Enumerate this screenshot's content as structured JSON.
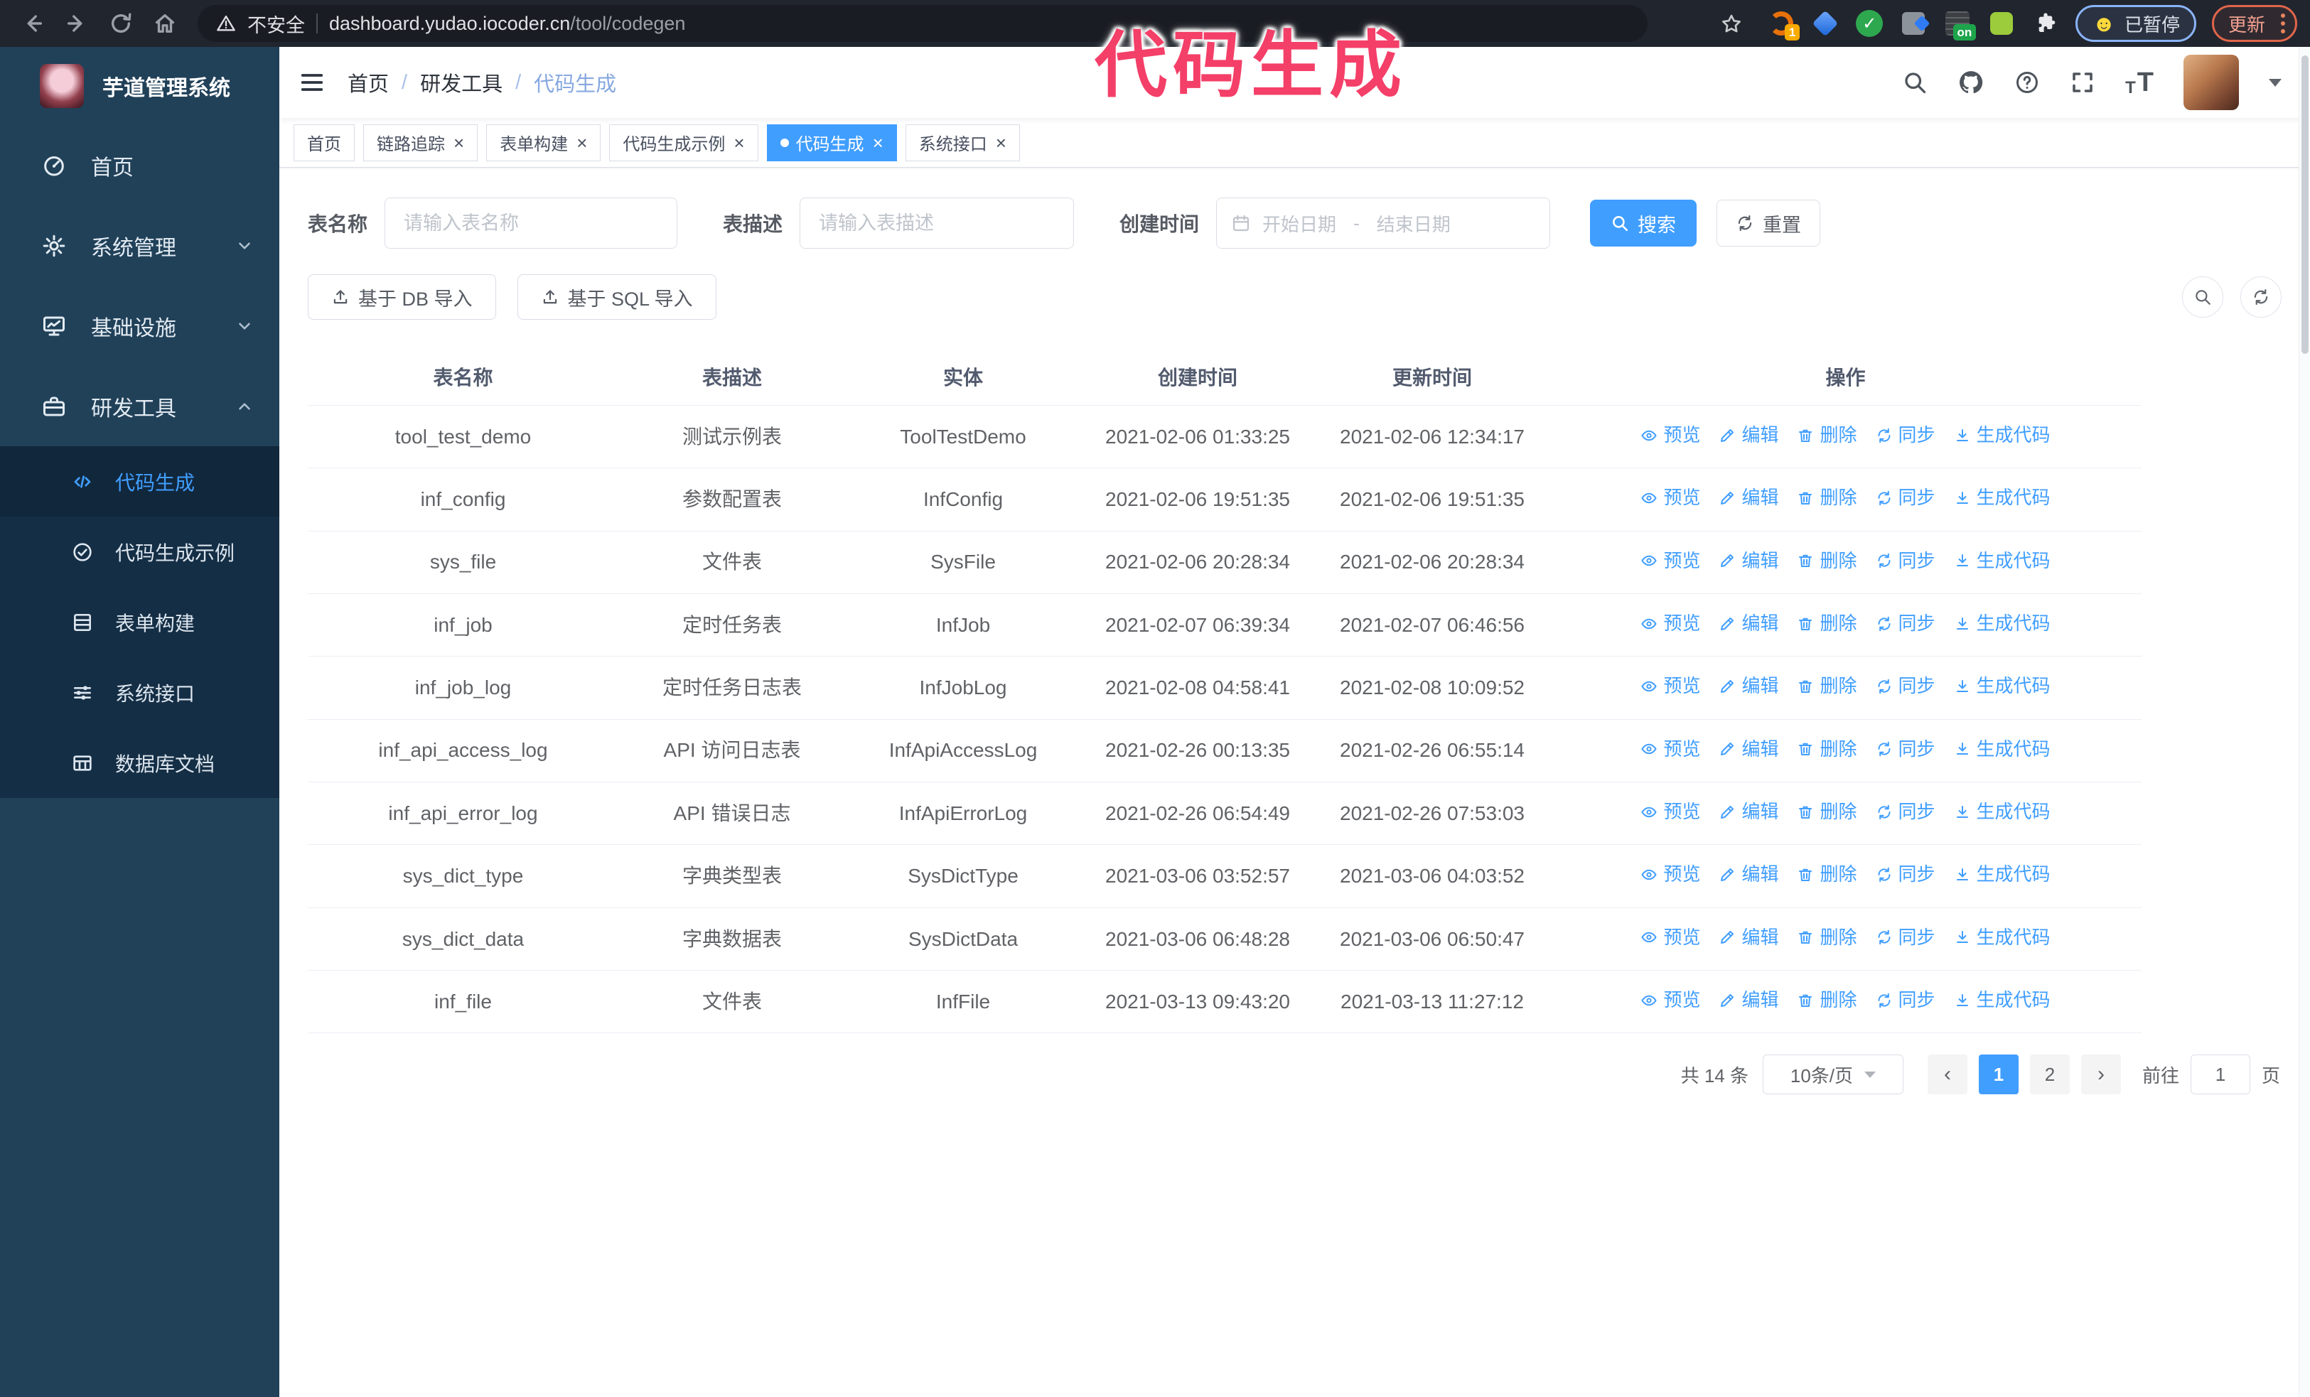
{
  "overlay": {
    "title": "代码生成",
    "color": "#f43f68"
  },
  "browser": {
    "security_label": "不安全",
    "url_host": "dashboard.yudao.iocoder.cn",
    "url_path": "/tool/codegen",
    "ext_badge": "1",
    "ext_on": "on",
    "paused_badge": "已暂停",
    "update_button": "更新"
  },
  "sidebar": {
    "logo_title": "芋道管理系统",
    "items": [
      {
        "label": "首页"
      },
      {
        "label": "系统管理"
      },
      {
        "label": "基础设施"
      },
      {
        "label": "研发工具"
      }
    ],
    "submenu": [
      {
        "label": "代码生成",
        "active": true
      },
      {
        "label": "代码生成示例",
        "active": false
      },
      {
        "label": "表单构建",
        "active": false
      },
      {
        "label": "系统接口",
        "active": false
      },
      {
        "label": "数据库文档",
        "active": false
      }
    ]
  },
  "breadcrumb": {
    "items": [
      "首页",
      "研发工具",
      "代码生成"
    ]
  },
  "tabs": [
    {
      "label": "首页",
      "closable": false,
      "active": false
    },
    {
      "label": "链路追踪",
      "closable": true,
      "active": false
    },
    {
      "label": "表单构建",
      "closable": true,
      "active": false
    },
    {
      "label": "代码生成示例",
      "closable": true,
      "active": false
    },
    {
      "label": "代码生成",
      "closable": true,
      "active": true
    },
    {
      "label": "系统接口",
      "closable": true,
      "active": false
    }
  ],
  "filters": {
    "table_name_label": "表名称",
    "table_name_placeholder": "请输入表名称",
    "table_desc_label": "表描述",
    "table_desc_placeholder": "请输入表描述",
    "create_time_label": "创建时间",
    "date_start_placeholder": "开始日期",
    "date_separator": "-",
    "date_end_placeholder": "结束日期",
    "search_label": "搜索",
    "reset_label": "重置"
  },
  "toolbar": {
    "import_db_label": "基于 DB 导入",
    "import_sql_label": "基于 SQL 导入"
  },
  "table": {
    "columns": [
      "表名称",
      "表描述",
      "实体",
      "创建时间",
      "更新时间",
      "操作"
    ],
    "actions": [
      "预览",
      "编辑",
      "删除",
      "同步",
      "生成代码"
    ],
    "rows": [
      [
        "tool_test_demo",
        "测试示例表",
        "ToolTestDemo",
        "2021-02-06 01:33:25",
        "2021-02-06 12:34:17"
      ],
      [
        "inf_config",
        "参数配置表",
        "InfConfig",
        "2021-02-06 19:51:35",
        "2021-02-06 19:51:35"
      ],
      [
        "sys_file",
        "文件表",
        "SysFile",
        "2021-02-06 20:28:34",
        "2021-02-06 20:28:34"
      ],
      [
        "inf_job",
        "定时任务表",
        "InfJob",
        "2021-02-07 06:39:34",
        "2021-02-07 06:46:56"
      ],
      [
        "inf_job_log",
        "定时任务日志表",
        "InfJobLog",
        "2021-02-08 04:58:41",
        "2021-02-08 10:09:52"
      ],
      [
        "inf_api_access_log",
        "API 访问日志表",
        "InfApiAccessLog",
        "2021-02-26 00:13:35",
        "2021-02-26 06:55:14"
      ],
      [
        "inf_api_error_log",
        "API 错误日志",
        "InfApiErrorLog",
        "2021-02-26 06:54:49",
        "2021-02-26 07:53:03"
      ],
      [
        "sys_dict_type",
        "字典类型表",
        "SysDictType",
        "2021-03-06 03:52:57",
        "2021-03-06 04:03:52"
      ],
      [
        "sys_dict_data",
        "字典数据表",
        "SysDictData",
        "2021-03-06 06:48:28",
        "2021-03-06 06:50:47"
      ],
      [
        "inf_file",
        "文件表",
        "InfFile",
        "2021-03-13 09:43:20",
        "2021-03-13 11:27:12"
      ]
    ]
  },
  "pagination": {
    "total": "共 14 条",
    "page_size": "10条/页",
    "pages": [
      "1",
      "2"
    ],
    "active_page": "1",
    "goto_label": "前往",
    "goto_value": "1",
    "page_suffix": "页"
  }
}
